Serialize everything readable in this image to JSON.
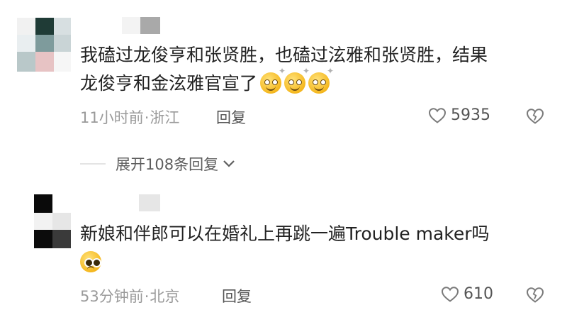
{
  "comments": [
    {
      "text_line1": "我磕过龙俊亨和张贤胜，也磕过泫雅和张贤胜，结果",
      "text_line2": "龙俊亨和金泫雅官宣了",
      "emojis": [
        "dizzy-face-emoji",
        "dizzy-face-emoji",
        "dizzy-face-emoji"
      ],
      "time": "11小时前",
      "location": "浙江",
      "reply_label": "回复",
      "likes": "5935"
    },
    {
      "text_line1": "新娘和伴郎可以在婚礼上再跳一遍Trouble maker吗",
      "emojis": [
        "pleading-face-emoji"
      ],
      "time": "53分钟前",
      "location": "北京",
      "reply_label": "回复",
      "likes": "610"
    }
  ],
  "expand_replies_label": "展开108条回复",
  "meta_separator": "·",
  "colors": {
    "text": "#222222",
    "meta": "#9a9a9a",
    "action": "#555555",
    "emoji": "#f5b81e"
  }
}
